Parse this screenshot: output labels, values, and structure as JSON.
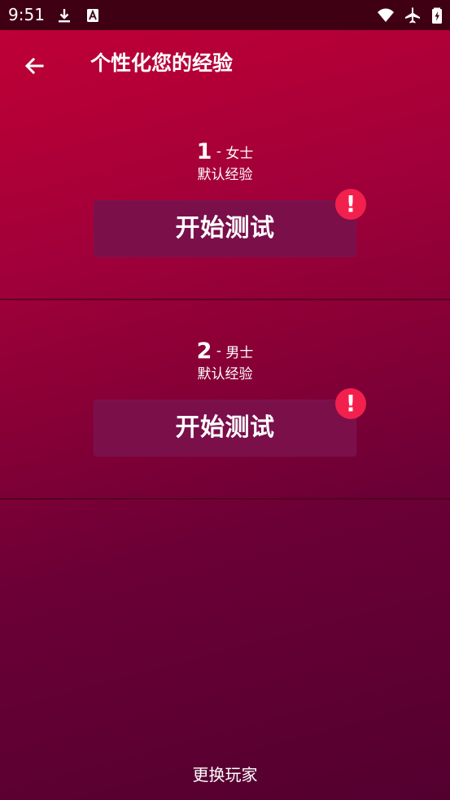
{
  "status_bar": {
    "time": "9:51",
    "icons": [
      "download-icon",
      "a-badge-icon",
      "wifi-icon",
      "airplane-icon",
      "battery-icon"
    ]
  },
  "header": {
    "title": "个性化您的经验",
    "back_icon": "arrow-left-icon"
  },
  "profiles": [
    {
      "number": "1",
      "separator": " - ",
      "gender": "女士",
      "experience": "默认经验",
      "button_label": "开始测试",
      "alert_icon": "exclamation-icon",
      "alert_text": "!"
    },
    {
      "number": "2",
      "separator": " - ",
      "gender": "男士",
      "experience": "默认经验",
      "button_label": "开始测试",
      "alert_icon": "exclamation-icon",
      "alert_text": "!"
    }
  ],
  "footer": {
    "switch_player_label": "更换玩家"
  },
  "colors": {
    "status_bar": "#3f0014",
    "background_top": "#c10037",
    "background_bottom": "#53002f",
    "button": "#7a0f4a",
    "alert": "#f2204d",
    "text": "#ffffff"
  }
}
